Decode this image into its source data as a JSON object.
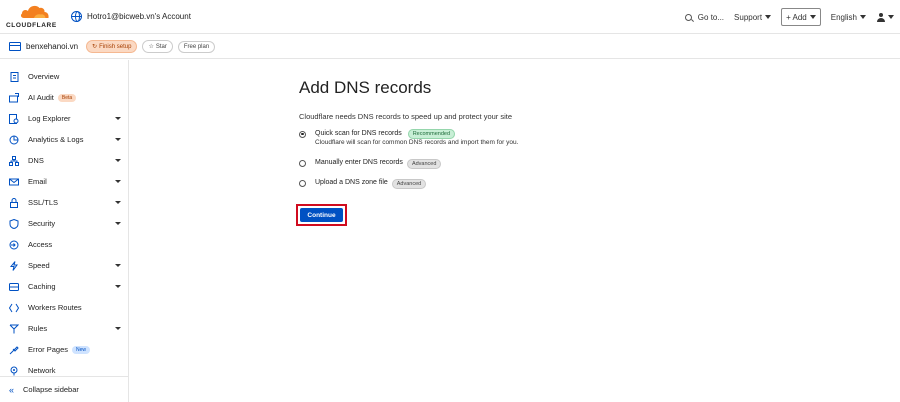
{
  "header": {
    "logo_text": "CLOUDFLARE",
    "account_name": "Hotro1@bicweb.vn's Account",
    "goto_label": "Go to...",
    "support_label": "Support",
    "add_label": "+ Add",
    "language_label": "English"
  },
  "zone": {
    "name": "benxehanoi.vn",
    "finish_setup_label": "Finish setup",
    "star_label": "Star",
    "plan_label": "Free plan"
  },
  "sidebar": {
    "items": [
      {
        "label": "Overview",
        "icon": "document-icon"
      },
      {
        "label": "AI Audit",
        "icon": "ai-audit-icon",
        "badge": "Beta"
      },
      {
        "label": "Log Explorer",
        "icon": "log-explorer-icon",
        "expandable": true
      },
      {
        "label": "Analytics & Logs",
        "icon": "analytics-icon",
        "expandable": true
      },
      {
        "label": "DNS",
        "icon": "dns-icon",
        "expandable": true
      },
      {
        "label": "Email",
        "icon": "email-icon",
        "expandable": true
      },
      {
        "label": "SSL/TLS",
        "icon": "lock-icon",
        "expandable": true
      },
      {
        "label": "Security",
        "icon": "shield-icon",
        "expandable": true
      },
      {
        "label": "Access",
        "icon": "access-icon"
      },
      {
        "label": "Speed",
        "icon": "lightning-icon",
        "expandable": true
      },
      {
        "label": "Caching",
        "icon": "caching-icon",
        "expandable": true
      },
      {
        "label": "Workers Routes",
        "icon": "workers-icon"
      },
      {
        "label": "Rules",
        "icon": "rules-icon",
        "expandable": true
      },
      {
        "label": "Error Pages",
        "icon": "error-pages-icon",
        "badge": "New"
      },
      {
        "label": "Network",
        "icon": "network-icon"
      }
    ],
    "collapse_label": "Collapse sidebar"
  },
  "main": {
    "title": "Add DNS records",
    "subtitle": "Cloudflare needs DNS records to speed up and protect your site",
    "options": [
      {
        "label": "Quick scan for DNS records",
        "tag": "Recommended",
        "helper": "Cloudflare will scan for common DNS records and import them for you.",
        "selected": true
      },
      {
        "label": "Manually enter DNS records",
        "tag": "Advanced",
        "selected": false
      },
      {
        "label": "Upload a DNS zone file",
        "tag": "Advanced",
        "selected": false
      }
    ],
    "continue_label": "Continue"
  },
  "colors": {
    "accent": "#0051c3",
    "logo_orange": "#f38020",
    "highlight": "#d00b1f"
  }
}
